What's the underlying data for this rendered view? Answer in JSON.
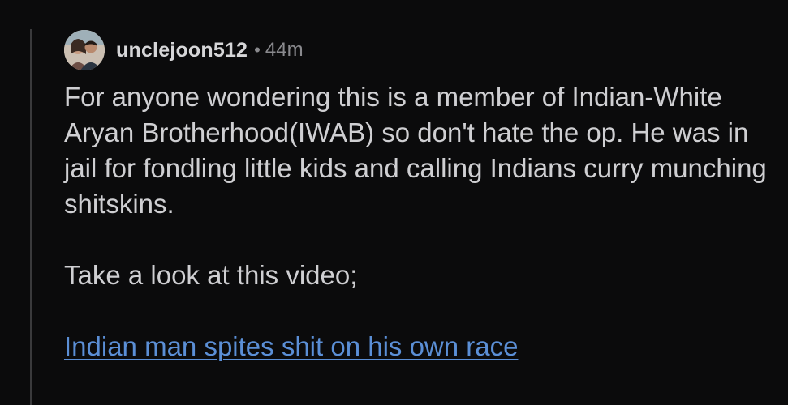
{
  "comment": {
    "username": "unclejoon512",
    "separator": "•",
    "timestamp": "44m",
    "avatar_icon": "user-avatar-icon",
    "paragraphs": [
      "For anyone wondering this is a member of Indian-White Aryan Brotherhood(IWAB) so don't hate the op. He was in jail for fondling little kids and calling Indians curry munching shitskins.",
      "Take a look at this video;"
    ],
    "link_text": "Indian man spites shit on his own race"
  },
  "colors": {
    "background": "#0b0b0c",
    "text": "#cfcfd2",
    "muted": "#8a8a8e",
    "link": "#5b8fd6",
    "thread_line": "#3a3a3c"
  }
}
